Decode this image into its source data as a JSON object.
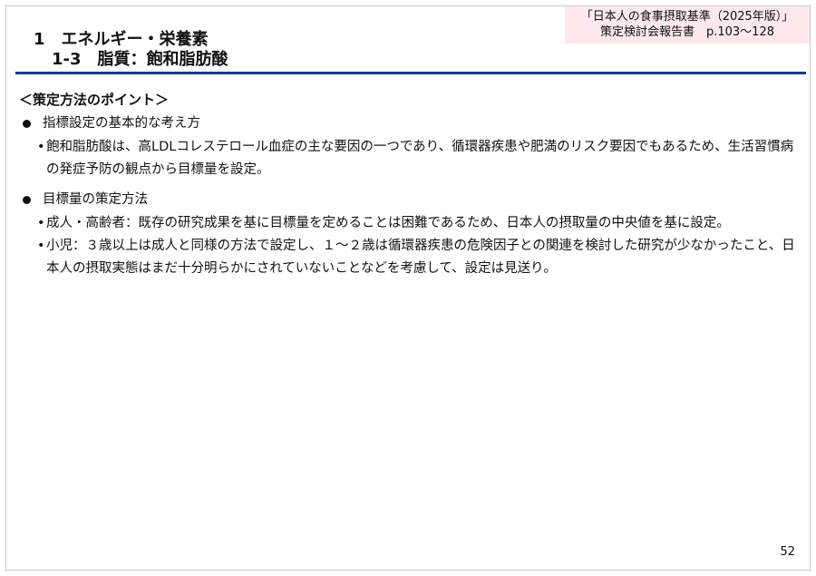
{
  "source": {
    "line1": "「日本人の食事摂取基準（2025年版）」",
    "line2": "策定検討会報告書　p.103～128"
  },
  "title": {
    "main": "1　エネルギー・栄養素",
    "sub": "1-3　脂質：飽和脂肪酸"
  },
  "content": {
    "heading": "＜策定方法のポイント＞",
    "sections": [
      {
        "label": "指標設定の基本的な考え方",
        "items": [
          "飽和脂肪酸は、高LDLコレステロール血症の主な要因の一つであり、循環器疾患や肥満のリスク要因でもあるため、生活習慣病の発症予防の観点から目標量を設定。"
        ]
      },
      {
        "label": "目標量の策定方法",
        "items": [
          "成人・高齢者：既存の研究成果を基に目標量を定めることは困難であるため、日本人の摂取量の中央値を基に設定。",
          "小児：３歳以上は成人と同様の方法で設定し、１～２歳は循環器疾患の危険因子との関連を検討した研究が少なかったこと、日本人の摂取実態はまだ十分明らかにされていないことなどを考慮して、設定は見送り。"
        ]
      }
    ]
  },
  "page_number": "52",
  "colors": {
    "rule": "#1f3a7a",
    "source_bg": "#fde9ec"
  }
}
